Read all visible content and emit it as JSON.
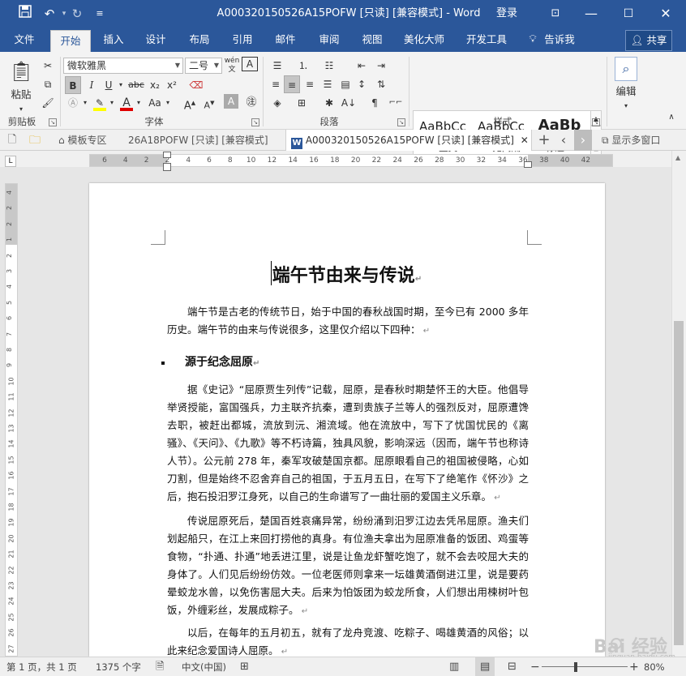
{
  "titlebar": {
    "document_title": "A000320150526A15POFW [只读] [兼容模式]  -  Word",
    "login": "登录"
  },
  "ribbon_tabs": [
    "文件",
    "开始",
    "插入",
    "设计",
    "布局",
    "引用",
    "邮件",
    "审阅",
    "视图",
    "美化大师",
    "开发工具",
    "告诉我"
  ],
  "share_label": "共享",
  "ribbon": {
    "clipboard": {
      "paste": "粘贴",
      "group": "剪贴板"
    },
    "font": {
      "family": "微软雅黑",
      "size": "二号",
      "group": "字体",
      "pinyin": "wén",
      "aa": "Aa",
      "bold": "B",
      "italic": "I",
      "underline": "U",
      "strike": "abc",
      "sub": "x₂",
      "sup": "x²",
      "fontcolor_letter": "A"
    },
    "paragraph": {
      "group": "段落"
    },
    "styles": {
      "group": "样式",
      "items": [
        {
          "sample": "AaBbCc",
          "name": "↵ 正文"
        },
        {
          "sample": "AaBbCc",
          "name": "↵ 无间隔"
        },
        {
          "sample": "AaBb",
          "name": "标题 1"
        }
      ]
    },
    "editing": {
      "group": "编辑"
    }
  },
  "doc_tabs": {
    "template": "模板专区",
    "tab1": "26A18POFW [只读] [兼容模式]",
    "tab2": "A000320150526A15POFW [只读] [兼容模式]",
    "show_multi": "显示多窗口"
  },
  "hruler_ticks": [
    "6",
    "4",
    "2",
    "2",
    "4",
    "6",
    "8",
    "10",
    "12",
    "14",
    "16",
    "18",
    "20",
    "22",
    "24",
    "26",
    "28",
    "30",
    "32",
    "34",
    "36",
    "38",
    "40",
    "42"
  ],
  "vruler_ticks": [
    "4",
    "2",
    "2",
    "1",
    "2",
    "3",
    "4",
    "5",
    "6",
    "7",
    "8",
    "9",
    "10",
    "11",
    "12",
    "13",
    "14",
    "15",
    "16",
    "17",
    "18",
    "19",
    "20",
    "21",
    "22",
    "23",
    "24",
    "25",
    "26",
    "27"
  ],
  "document": {
    "title": "端午节由来与传说",
    "intro": "端午节是古老的传统节日，始于中国的春秋战国时期，至今已有 2000 多年历史。端午节的由来与传说很多，这里仅介绍以下四种：",
    "heading1": "源于纪念屈原",
    "p1": "据《史记》“屈原贾生列传”记载，屈原，是春秋时期楚怀王的大臣。他倡导举贤授能，富国强兵，力主联齐抗秦，遭到贵族子兰等人的强烈反对，屈原遭馋去职，被赶出都城，流放到沅、湘流域。他在流放中，写下了忧国忧民的《离骚》、《天问》、《九歌》等不朽诗篇，独具风貌，影响深远（因而，端午节也称诗人节）。公元前 278 年，秦军攻破楚国京都。屈原眼看自己的祖国被侵略，心如刀割，但是始终不忍舍弃自己的祖国，于五月五日，在写下了绝笔作《怀沙》之后，抱石投汨罗江身死，以自己的生命谱写了一曲壮丽的爱国主义乐章。",
    "p2": "传说屈原死后，楚国百姓哀痛异常，纷纷涌到汨罗江边去凭吊屈原。渔夫们划起船只，在江上来回打捞他的真身。有位渔夫拿出为屈原准备的饭团、鸡蛋等食物，“扑通、扑通”地丢进江里，说是让鱼龙虾蟹吃饱了，就不会去咬屈大夫的身体了。人们见后纷纷仿效。一位老医师则拿来一坛雄黄酒倒进江里，说是要药晕蛟龙水兽，以免伤害屈大夫。后来为怕饭团为蛟龙所食，人们想出用楝树叶包饭，外缠彩丝，发展成粽子。",
    "p3": "以后，在每年的五月初五，就有了龙舟竞渡、吃粽子、喝雄黄酒的风俗；以此来纪念爱国诗人屈原。"
  },
  "status": {
    "page": "第 1 页，共 1 页",
    "words": "1375 个字",
    "language": "中文(中国)",
    "zoom": "80%"
  },
  "watermark": {
    "brand": "Bai 经验",
    "url": "jingyan.baidu.com"
  },
  "colors": {
    "accent": "#2b579a",
    "highlight": "#ffff00",
    "font_red": "#e00000"
  }
}
